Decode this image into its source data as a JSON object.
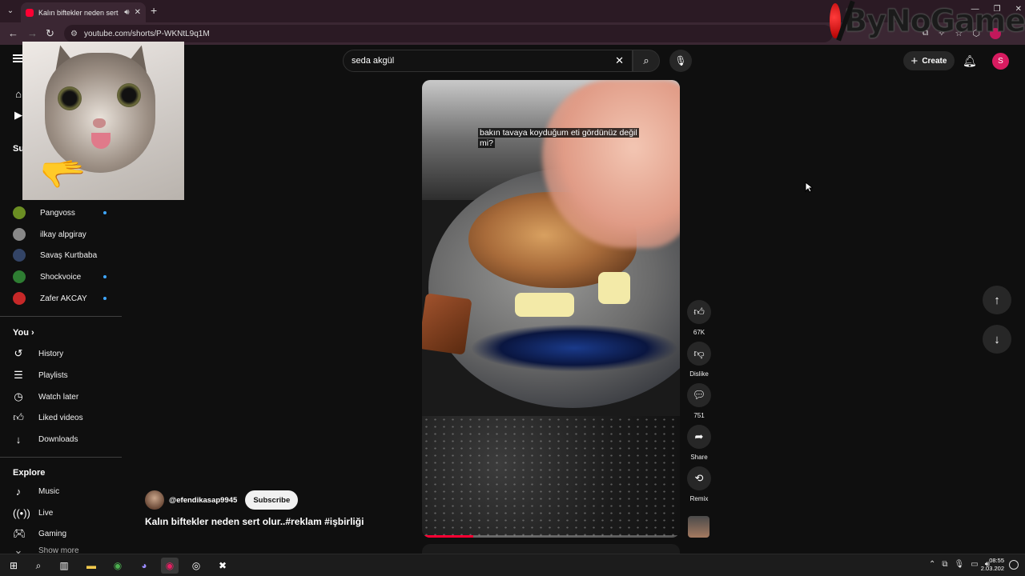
{
  "browser": {
    "tab_title": "Kalın biftekler neden sert ol",
    "url": "youtube.com/shorts/P-WKNtL9q1M"
  },
  "watermark": {
    "text": "ByNoGame"
  },
  "header": {
    "search_value": "seda akgül",
    "create_label": "Create",
    "avatar_letter": "S"
  },
  "sidebar": {
    "subs_title": "Su",
    "subscriptions": [
      {
        "name": "Pangvoss",
        "new": true,
        "color": "#6b8e23"
      },
      {
        "name": "ilkay alpgiray",
        "new": false,
        "color": "#888888"
      },
      {
        "name": "Savaş Kurtbaba",
        "new": false,
        "color": "#334466"
      },
      {
        "name": "Shockvoice",
        "new": true,
        "color": "#2e7d32"
      },
      {
        "name": "Zafer AKCAY",
        "new": true,
        "color": "#c62828"
      }
    ],
    "you_title": "You",
    "you_items": [
      {
        "label": "History",
        "icon": "history-icon"
      },
      {
        "label": "Playlists",
        "icon": "playlists-icon"
      },
      {
        "label": "Watch later",
        "icon": "watch-later-icon"
      },
      {
        "label": "Liked videos",
        "icon": "liked-videos-icon"
      },
      {
        "label": "Downloads",
        "icon": "downloads-icon"
      }
    ],
    "explore_title": "Explore",
    "explore_items": [
      {
        "label": "Music",
        "icon": "music-icon"
      },
      {
        "label": "Live",
        "icon": "live-icon"
      },
      {
        "label": "Gaming",
        "icon": "gaming-icon"
      }
    ],
    "show_more": "Show more"
  },
  "short": {
    "caption": "bakın tavaya koyduğum eti gördünüz değil mi?",
    "progress": 0.2,
    "channel_handle": "@efendikasap9945",
    "subscribe_label": "Subscribe",
    "title": "Kalın biftekler neden sert olur..#reklam #işbirliği",
    "actions": {
      "likes": "67K",
      "dislike": "Dislike",
      "comments": "751",
      "share": "Share",
      "remix": "Remix"
    }
  },
  "taskbar": {
    "time": "08:55",
    "date": "2.03.202"
  }
}
